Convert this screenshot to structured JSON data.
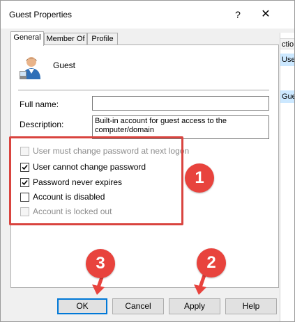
{
  "window": {
    "title": "Guest Properties",
    "help_label": "?",
    "close_label": "✕"
  },
  "background_window": {
    "header_text": "ctio",
    "row1_text": "User",
    "row2_text": "Gues"
  },
  "tabs": [
    {
      "label": "General",
      "active": true
    },
    {
      "label": "Member Of",
      "active": false
    },
    {
      "label": "Profile",
      "active": false
    }
  ],
  "general": {
    "user_name": "Guest",
    "full_name_label": "Full name:",
    "full_name_value": "",
    "description_label": "Description:",
    "description_value": "Built-in account for guest access to the computer/domain"
  },
  "checkboxes": [
    {
      "label": "User must change password at next logon",
      "checked": false,
      "enabled": false
    },
    {
      "label": "User cannot change password",
      "checked": true,
      "enabled": true
    },
    {
      "label": "Password never expires",
      "checked": true,
      "enabled": true
    },
    {
      "label": "Account is disabled",
      "checked": false,
      "enabled": true
    },
    {
      "label": "Account is locked out",
      "checked": false,
      "enabled": false
    }
  ],
  "annotations": {
    "badge1": "1",
    "badge2": "2",
    "badge3": "3",
    "accent_color": "#e8433d"
  },
  "buttons": {
    "ok": "OK",
    "cancel": "Cancel",
    "apply": "Apply",
    "help": "Help"
  }
}
